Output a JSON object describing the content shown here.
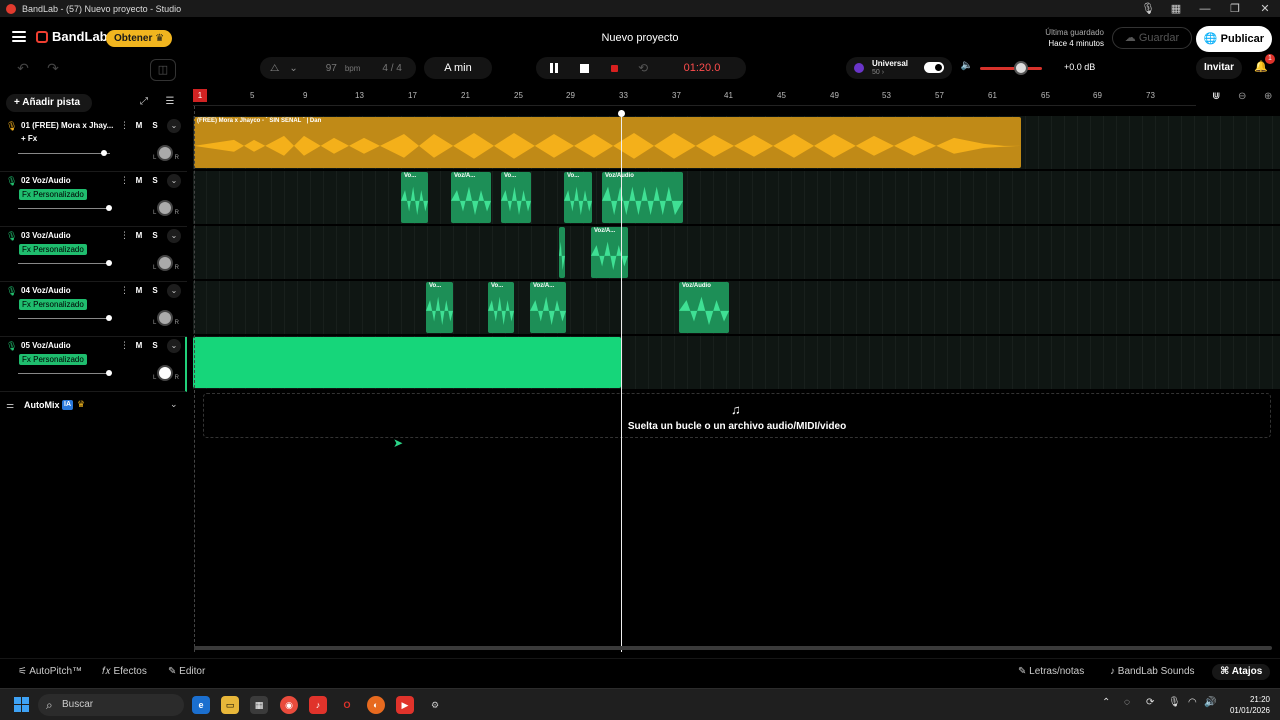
{
  "window": {
    "title": "BandLab - (57) Nuevo proyecto - Studio"
  },
  "header": {
    "brand": "BandLab",
    "obtain_label": "Obtener",
    "project_title": "Nuevo proyecto",
    "last_saved_label": "Última guardado",
    "last_saved_time": "Hace 4 minutos",
    "save_label": "Guardar",
    "publish_label": "Publicar"
  },
  "transport": {
    "bpm": "97",
    "bpm_unit": "bpm",
    "time_signature": "4 / 4",
    "key": "A min",
    "timecode": "01:20.0",
    "preset_name": "Universal",
    "preset_value": "50 ›",
    "master_db": "+0.0 dB",
    "invite_label": "Invitar",
    "notification_count": "1",
    "master_volume_level": 0.66
  },
  "left_panel": {
    "add_track_label": "Añadir pista",
    "tracks": [
      {
        "name": "01  (FREE) Mora x Jhay...",
        "fx": "+ Fx",
        "custom_fx": false
      },
      {
        "name": "02  Voz/Audio",
        "fx": "Fx Personalizado",
        "custom_fx": true
      },
      {
        "name": "03  Voz/Audio",
        "fx": "Fx Personalizado",
        "custom_fx": true
      },
      {
        "name": "04  Voz/Audio",
        "fx": "Fx Personalizado",
        "custom_fx": true
      },
      {
        "name": "05  Voz/Audio",
        "fx": "Fx Personalizado",
        "custom_fx": true
      }
    ],
    "mute_label": "M",
    "solo_label": "S",
    "pan_left": "L",
    "pan_right": "R",
    "automix_label": "AutoMix",
    "automix_badge": "IA"
  },
  "ruler": {
    "first": "1",
    "marks": [
      "5",
      "9",
      "13",
      "17",
      "21",
      "25",
      "29",
      "33",
      "37",
      "41",
      "45",
      "49",
      "53",
      "57",
      "61",
      "65",
      "69",
      "73"
    ]
  },
  "clips": {
    "track1_label": "(FREE) Mora x Jhayco - ` SIN SEÑAL `   |   Dan",
    "voz_short": "Vo...",
    "voz_mid": "Voz/A...",
    "voz_full": "Voz/Audio"
  },
  "dropzone": {
    "text": "Suelta un bucle o un archivo audio/MIDI/video"
  },
  "bottom_bar": {
    "autopitch": "AutoPitch™",
    "effects": "Efectos",
    "editor": "Editor",
    "lyrics": "Letras/notas",
    "sounds": "BandLab Sounds",
    "shortcuts": "Atajos"
  },
  "taskbar": {
    "search_placeholder": "Buscar",
    "time": "21:20",
    "date": "01/01/2026"
  }
}
